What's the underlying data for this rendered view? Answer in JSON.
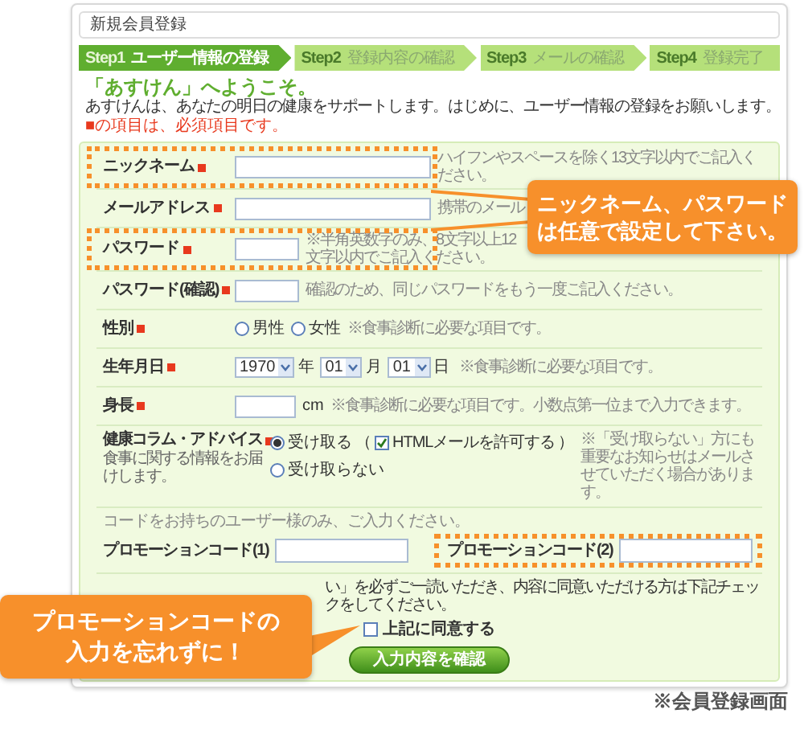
{
  "page_title": "新規会員登録",
  "steps": [
    {
      "number": "Step1",
      "label": "ユーザー情報の登録",
      "selected": true
    },
    {
      "number": "Step2",
      "label": "登録内容の確認",
      "selected": false
    },
    {
      "number": "Step3",
      "label": "メールの確認",
      "selected": false
    },
    {
      "number": "Step4",
      "label": "登録完了",
      "selected": false
    }
  ],
  "welcome": {
    "heading": "「あすけん」へようこそ。",
    "text": "あすけんは、あなたの明日の健康をサポートします。はじめに、ユーザー情報の登録をお願いします。",
    "required_note": "■の項目は、必須項目です。"
  },
  "fields": [
    {
      "kind": "text",
      "label": "ニックネーム",
      "required": true,
      "highlighted": true,
      "hint": "ハイフンやスペースを除く13文字以内でご記入ください。"
    },
    {
      "kind": "text",
      "label": "メールアドレス",
      "required": true,
      "highlighted": false,
      "hint": "携帯のメール"
    },
    {
      "kind": "password",
      "label": "パスワード",
      "required": true,
      "highlighted": true,
      "hint": "※半角英数字のみ、8文字以上12文字以内でご記入ください。"
    },
    {
      "kind": "password",
      "label": "パスワード(確認)",
      "required": true,
      "highlighted": false,
      "hint": "確認のため、同じパスワードをもう一度ご記入ください。"
    },
    {
      "kind": "radio",
      "label": "性別",
      "required": true,
      "highlighted": false,
      "options": [
        {
          "label": "男性",
          "selected": false
        },
        {
          "label": "女性",
          "selected": false
        }
      ],
      "hint": "※食事診断に必要な項目です。"
    },
    {
      "kind": "date",
      "label": "生年月日",
      "required": true,
      "highlighted": false,
      "selects": [
        {
          "value": "1970",
          "unit": "年"
        },
        {
          "value": "01",
          "unit": "月"
        },
        {
          "value": "01",
          "unit": "日"
        }
      ],
      "hint": "※食事診断に必要な項目です。"
    },
    {
      "kind": "number",
      "label": "身長",
      "required": true,
      "highlighted": false,
      "unit": "cm",
      "hint": "※食事診断に必要な項目です。小数点第一位まで入力できます。"
    },
    {
      "kind": "subscription",
      "label": "健康コラム・アドバイス",
      "required": true,
      "highlighted": false,
      "sublabel": "食事に関する情報をお届けします。",
      "options": [
        {
          "label": "受け取る",
          "selected": true
        },
        {
          "label": "受け取らない",
          "selected": false
        }
      ],
      "html_mail": {
        "open": "（",
        "label": "HTMLメールを許可する",
        "close": "）",
        "checked": true
      },
      "hint": "※「受け取らない」方にも重要なお知らせはメールさせていただく場合があります。"
    }
  ],
  "promotion": {
    "caption": "コードをお持ちのユーザー様のみ、ご入力ください。",
    "fields": [
      {
        "label": "プロモーションコード(1)",
        "highlighted": false
      },
      {
        "label": "プロモーションコード(2)",
        "highlighted": true
      }
    ]
  },
  "terms": {
    "text": "い」を必ずご一読いただき、内容に同意いただける方は下記チェックをしてください。",
    "agree": {
      "label": "上記に同意する",
      "checked": false
    }
  },
  "submit_button": "入力内容を確認",
  "callouts": [
    {
      "lines": [
        "ニックネーム、パスワード",
        "は任意で設定して下さい。"
      ]
    },
    {
      "lines": [
        "プロモーションコードの",
        "入力を忘れずに！"
      ]
    }
  ],
  "caption": "※会員登録画面"
}
